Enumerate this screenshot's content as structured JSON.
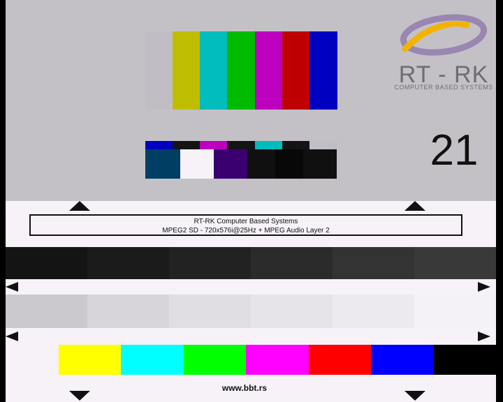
{
  "logo": {
    "brand": "RT - RK",
    "subtitle": "COMPUTER BASED SYSTEMS",
    "swoosh_color": "#9a86b3",
    "accent_color": "#f2b300"
  },
  "channel_number": "21",
  "info": {
    "line1": "RT-RK Computer Based Systems",
    "line2": "MPEG2 SD - 720x576i@25Hz + MPEG Audio Layer 2"
  },
  "footer": {
    "url": "www.bbt.rs"
  },
  "colors": {
    "colorbars_top": [
      "#c0bdc4",
      "#bfbd00",
      "#00bcbd",
      "#00bb00",
      "#bc00bd",
      "#bf0000",
      "#0000c0"
    ],
    "colorbars_mid": [
      "#0000c0",
      "#141414",
      "#bc00bd",
      "#141414",
      "#00bcbd",
      "#141414",
      "#c0bdc4"
    ],
    "colorbars_low": [
      "#003f63",
      "#f6f2f8",
      "#3a0070",
      "#101010",
      "#080808",
      "#101010",
      "#101010"
    ],
    "gray_steps": [
      "#141414",
      "#1b1b1b",
      "#222222",
      "#2b2b2b",
      "#333333",
      "#393939"
    ],
    "light_steps": [
      "#cbc8ce",
      "#d7d4da",
      "#e0dde3",
      "#e6e3e9",
      "#ece9ef",
      "#f4f1f7"
    ],
    "bottom_bars": [
      "#ffff00",
      "#00ffff",
      "#00ff00",
      "#ff00ff",
      "#ff0000",
      "#0000ff",
      "#000000"
    ]
  }
}
